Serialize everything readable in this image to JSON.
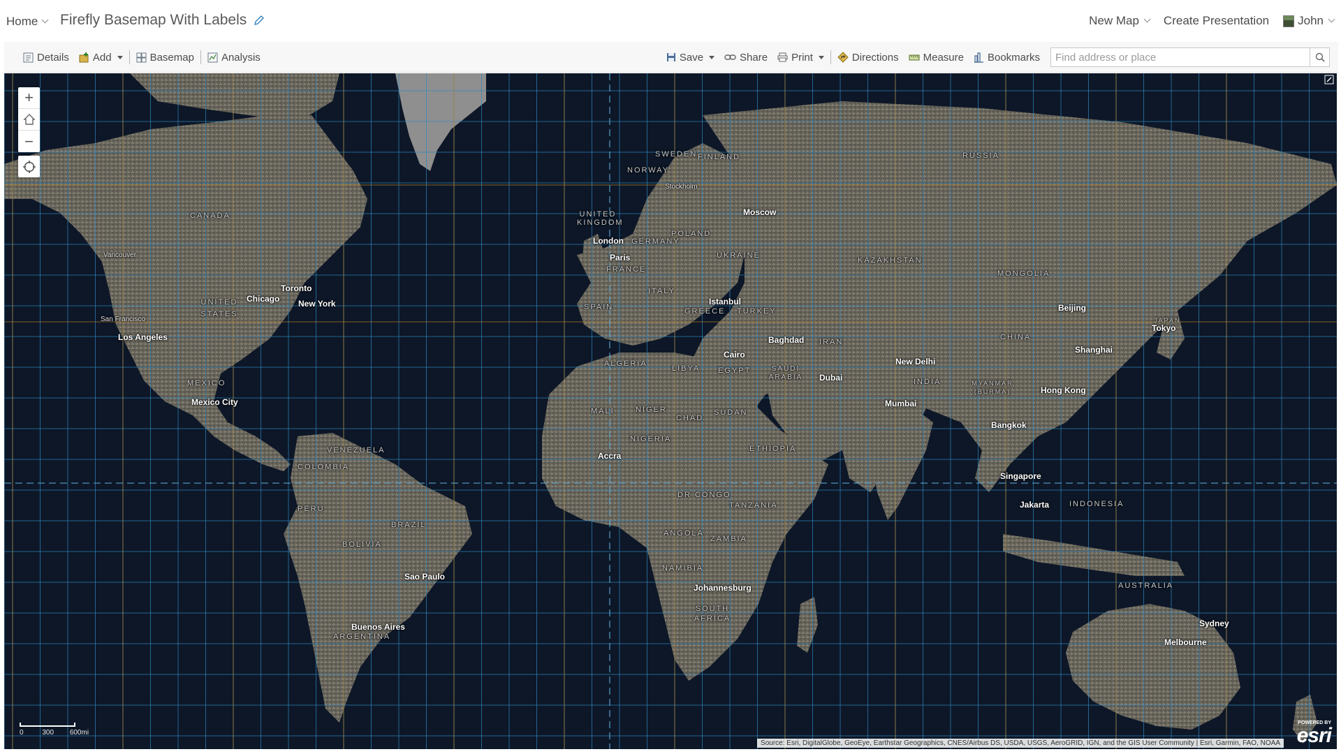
{
  "header": {
    "home_label": "Home",
    "map_title": "Firefly Basemap With Labels",
    "new_map_label": "New Map",
    "create_presentation_label": "Create Presentation",
    "user_name": "John"
  },
  "toolbar": {
    "details_label": "Details",
    "add_label": "Add",
    "basemap_label": "Basemap",
    "analysis_label": "Analysis",
    "save_label": "Save",
    "share_label": "Share",
    "print_label": "Print",
    "directions_label": "Directions",
    "measure_label": "Measure",
    "bookmarks_label": "Bookmarks",
    "search_placeholder": "Find address or place"
  },
  "map": {
    "zoom_in": "+",
    "zoom_out": "−",
    "scale_labels": [
      "0",
      "300",
      "600mi"
    ],
    "attribution": "Source: Esri, DigitalGlobe, GeoEye, Earthstar Geographics, CNES/Airbus DS, USDA, USGS, AeroGRID, IGN, and the GIS User Community | Esri, Garmin, FAO, NOAA",
    "powered_by": "POWERED BY",
    "esri_logo": "esri",
    "cities": {
      "vancouver": "Vancouver",
      "san_francisco": "San Francisco",
      "los_angeles": "Los Angeles",
      "chicago": "Chicago",
      "toronto": "Toronto",
      "new_york": "New York",
      "mexico_city": "Mexico City",
      "sao_paulo": "Sao Paulo",
      "buenos_aires": "Buenos Aires",
      "london": "London",
      "paris": "Paris",
      "stockholm": "Stockholm",
      "moscow": "Moscow",
      "istanbul": "Istanbul",
      "cairo": "Cairo",
      "baghdad": "Baghdad",
      "dubai": "Dubai",
      "accra": "Accra",
      "johannesburg": "Johannesburg",
      "new_delhi": "New Delhi",
      "mumbai": "Mumbai",
      "beijing": "Beijing",
      "tokyo": "Tokyo",
      "shanghai": "Shanghai",
      "hong_kong": "Hong Kong",
      "bangkok": "Bangkok",
      "singapore": "Singapore",
      "jakarta": "Jakarta",
      "sydney": "Sydney",
      "melbourne": "Melbourne"
    },
    "countries": {
      "canada": "CANADA",
      "united_states": "UNITED STATES",
      "mexico": "MEXICO",
      "venezuela": "VENEZUELA",
      "colombia": "COLOMBIA",
      "peru": "PERU",
      "brazil": "BRAZIL",
      "bolivia": "BOLIVIA",
      "argentina": "ARGENTINA",
      "sweden": "SWEDEN",
      "finland": "FINLAND",
      "norway": "NORWAY",
      "united_kingdom": "UNITED KINGDOM",
      "germany": "GERMANY",
      "poland": "POLAND",
      "ukraine": "UKRAINE",
      "france": "FRANCE",
      "spain": "SPAIN",
      "italy": "ITALY",
      "greece": "GREECE",
      "turkey": "TURKEY",
      "russia": "RUSSIA",
      "kazakhstan": "KAZAKHSTAN",
      "mongolia": "MONGOLIA",
      "china": "CHINA",
      "japan": "JAPAN",
      "iran": "IRAN",
      "india": "INDIA",
      "myanmar": "MYANMAR (BURMA)",
      "algeria": "ALGERIA",
      "libya": "LIBYA",
      "egypt": "EGYPT",
      "saudi_arabia": "SAUDI ARABIA",
      "mali": "MALI",
      "niger": "NIGER",
      "chad": "CHAD",
      "sudan": "SUDAN",
      "nigeria": "NIGERIA",
      "ethiopia": "ETHIOPIA",
      "dr_congo": "DR CONGO",
      "tanzania": "TANZANIA",
      "angola": "ANGOLA",
      "zambia": "ZAMBIA",
      "namibia": "NAMIBIA",
      "south_africa": "SOUTH AFRICA",
      "indonesia": "INDONESIA",
      "australia": "AUSTRALIA"
    }
  }
}
